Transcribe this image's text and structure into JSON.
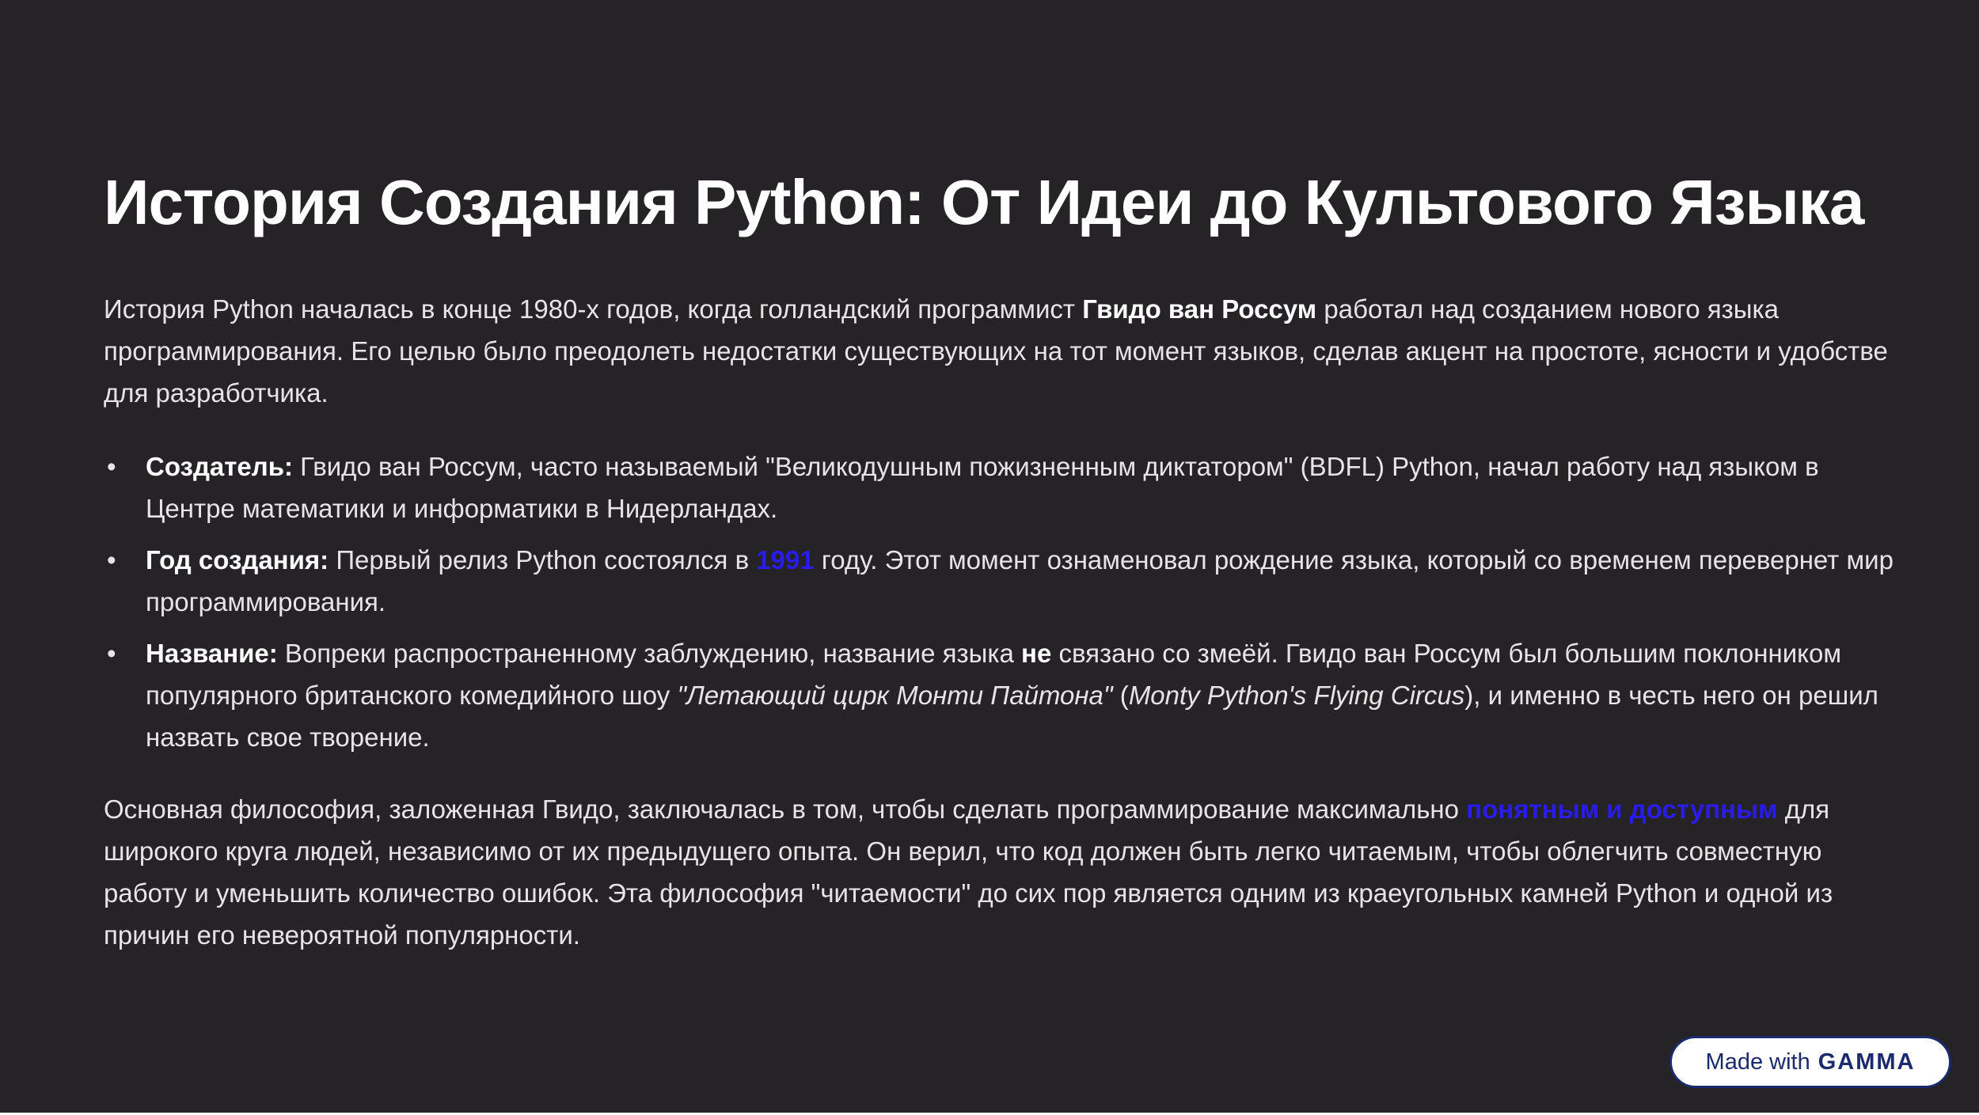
{
  "title": "История Создания Python: От Идеи до Культового Языка",
  "intro": {
    "part1": "История Python началась в конце 1980-х годов, когда голландский программист ",
    "bold": "Гвидо ван Россум",
    "part2": " работал над созданием нового языка программирования. Его целью было преодолеть недостатки существующих на тот момент языков, сделав акцент на простоте, ясности и удобстве для разработчика."
  },
  "bullets": [
    {
      "label": "Создатель:",
      "text": " Гвидо ван Россум, часто называемый \"Великодушным пожизненным диктатором\" (BDFL) Python, начал работу над языком в Центре математики и информатики в Нидерландах."
    },
    {
      "label": "Год создания:",
      "text_before": " Первый релиз Python состоялся в ",
      "accent": "1991",
      "text_after": " году. Этот момент ознаменовал рождение языка, который со временем перевернет мир программирования."
    },
    {
      "label": "Название:",
      "text1": " Вопреки распространенному заблуждению, название языка ",
      "bold": "не",
      "text2": " связано со змеёй. Гвидо ван Россум был большим поклонником популярного британского комедийного шоу ",
      "italic1": "\"Летающий цирк Монти Пайтона\"",
      "text3": " (",
      "italic2": "Monty Python's Flying Circus",
      "text4": "), и именно в честь него он решил назвать свое творение."
    }
  ],
  "outro": {
    "part1": "Основная философия, заложенная Гвидо, заключалась в том, чтобы сделать программирование максимально ",
    "accent": "понятным и доступным",
    "part2": " для широкого круга людей, независимо от их предыдущего опыта. Он верил, что код должен быть легко читаемым, чтобы облегчить совместную работу и уменьшить количество ошибок. Эта философия \"читаемости\" до сих пор является одним из краеугольных камней Python и одной из причин его невероятной популярности."
  },
  "badge": {
    "prefix": "Made with",
    "brand": "GAMMA"
  },
  "colors": {
    "background": "#252326",
    "accent": "#2a1ce8",
    "text": "#e6e4e8",
    "badge_border": "#1a2a6c"
  }
}
